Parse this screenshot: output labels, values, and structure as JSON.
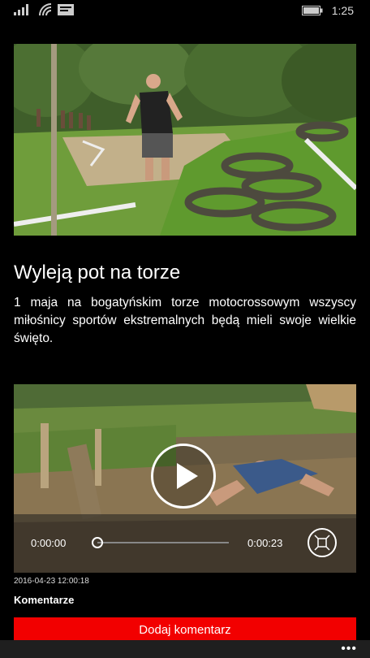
{
  "status_bar": {
    "time": "1:25",
    "icons": [
      "signal-icon",
      "wifi-icon",
      "message-icon",
      "battery-icon"
    ]
  },
  "article": {
    "hero_image": "photo-runner-on-motocross-track",
    "title": "Wyleją pot na torze",
    "lead": "1 maja na bogatyńskim torze motocrossowym wszyscy miłośnicy sportów ekstremalnych będą mieli swoje wielkie święto."
  },
  "video": {
    "current_time": "0:00:00",
    "duration": "0:00:23",
    "progress": 0,
    "icons": [
      "play-icon",
      "fullscreen-icon"
    ]
  },
  "meta": {
    "date": "2016-04-23 12:00:18"
  },
  "comments": {
    "heading": "Komentarze",
    "add_button": "Dodaj komentarz"
  },
  "app_bar": {
    "more_label": "•••"
  },
  "colors": {
    "accent": "#f20000",
    "background": "#000000"
  }
}
